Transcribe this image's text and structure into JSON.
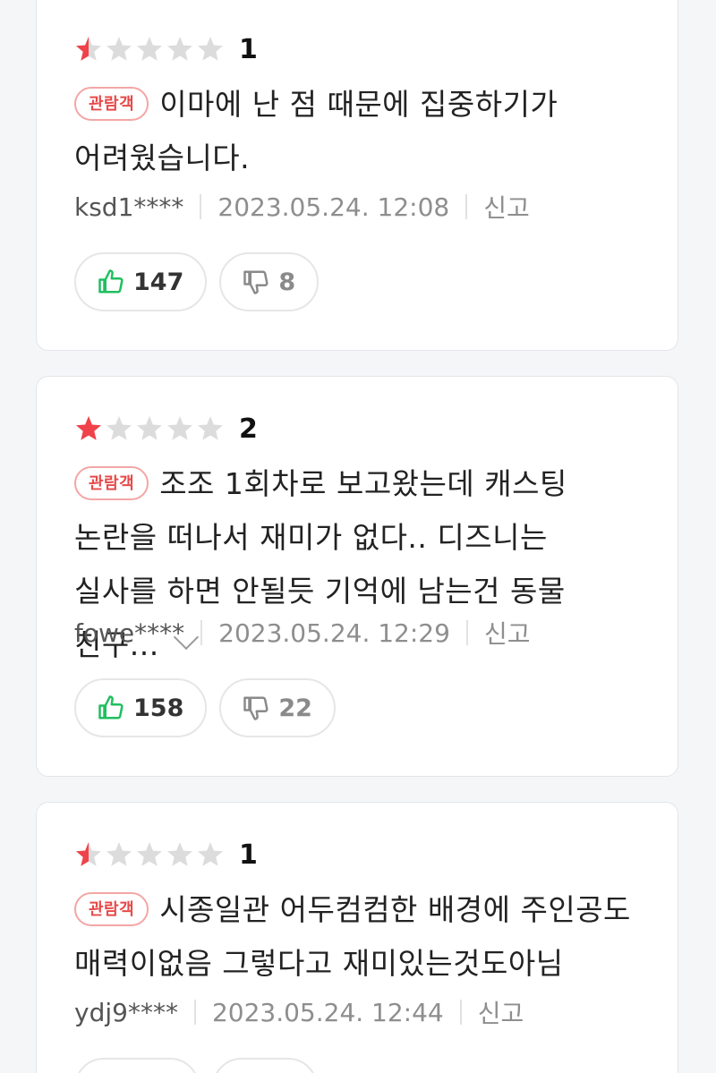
{
  "colors": {
    "star_filled": "#f0424a",
    "star_empty": "#dcdcdc",
    "badge_border": "#f4a6a6",
    "badge_text": "#e64a4a",
    "like_icon": "#1fbf5f"
  },
  "reviews": [
    {
      "rating": 1,
      "rating_text": "1",
      "badge": "관람객",
      "text": "이마에 난 점 때문에 집중하기가 어려웠습니다.",
      "user": "ksd1****",
      "date": "2023.05.24. 12:08",
      "report": "신고",
      "likes": "147",
      "dislikes": "8"
    },
    {
      "rating": 2,
      "rating_text": "2",
      "badge": "관람객",
      "text": "조조 1회차로 보고왔는데 캐스팅 논란을 떠나서 재미가 없다.. 디즈니는 실사를 하면 안될듯 기억에 남는건 동물 친구...",
      "user": "fowe****",
      "date": "2023.05.24. 12:29",
      "report": "신고",
      "likes": "158",
      "dislikes": "22"
    },
    {
      "rating": 1,
      "rating_text": "1",
      "badge": "관람객",
      "text": "시종일관 어두컴컴한 배경에 주인공도 매력이없음 그렇다고 재미있는것도아님",
      "user": "ydj9****",
      "date": "2023.05.24. 12:44",
      "report": "신고"
    }
  ]
}
